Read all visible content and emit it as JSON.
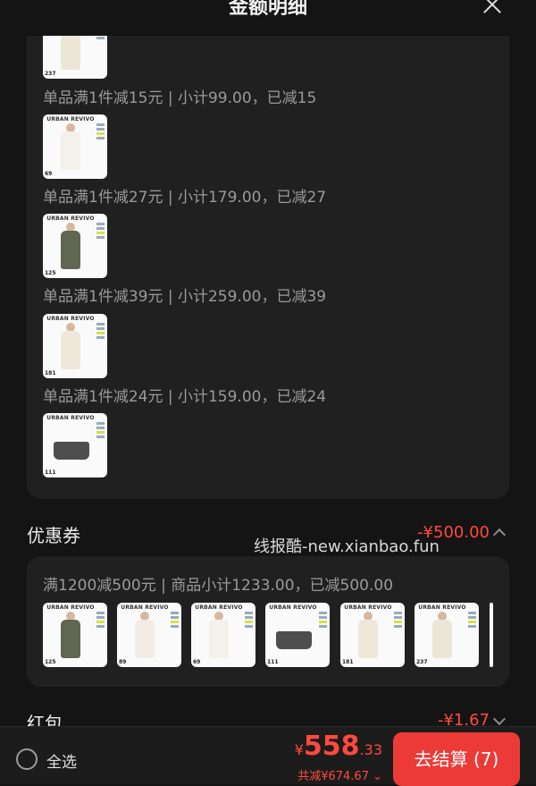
{
  "header": {
    "title": "金额明细",
    "close_icon": "close-icon"
  },
  "items": [
    {
      "rule": "单品满1件减15元 | 小计99.00，已减15",
      "thumb_price": "237"
    },
    {
      "rule": "单品满1件减27元 | 小计179.00，已减27",
      "thumb_price": "69"
    },
    {
      "rule": "单品满1件减39元 | 小计259.00，已减39",
      "thumb_price": "125"
    },
    {
      "rule": "单品满1件减24元 | 小计159.00，已减24",
      "thumb_price": "181"
    },
    {
      "rule": "",
      "thumb_price": "111"
    }
  ],
  "brand": "URBAN REVIVO",
  "coupon": {
    "title": "优惠券",
    "amount": "-¥500.00",
    "rule": "满1200减500元 | 商品小计1233.00，已减500.00",
    "thumb_prices": [
      "125",
      "89",
      "69",
      "111",
      "181",
      "237"
    ]
  },
  "watermark": "线报酷-new.xianbao.fun",
  "red_packet": {
    "title": "红包",
    "amount": "-¥1.67"
  },
  "bottom": {
    "select_all": "全选",
    "currency": "¥",
    "total_int": "558",
    "total_dec": ".33",
    "discount": "共减¥674.67",
    "checkout": "去结算 (7)"
  },
  "colors": {
    "accent": "#ec3b37",
    "price": "#ff4a3d",
    "background": "#141414",
    "card": "#202020"
  }
}
